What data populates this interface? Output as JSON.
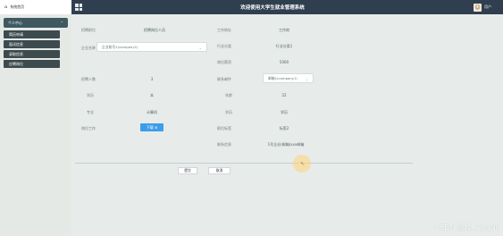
{
  "header": {
    "home_label": "系统首页",
    "title": "欢迎使用大学生就业管理系统",
    "user_name": "用户"
  },
  "sidebar": {
    "head_label": "个人中心",
    "items": [
      {
        "label": "简历申请"
      },
      {
        "label": "面试信息"
      },
      {
        "label": "录取信息"
      },
      {
        "label": "应聘岗位"
      }
    ]
  },
  "form": {
    "left": [
      {
        "label": "招聘职位",
        "value": "招聘岗位人员"
      },
      {
        "label": "企业名称",
        "value": "企业账号1(company1)"
      },
      {
        "label": "招聘人数",
        "value": "3"
      },
      {
        "label": "学历",
        "value": "本"
      },
      {
        "label": "专业",
        "value": "计算机"
      },
      {
        "label": "岗位工作",
        "button": "下载 ⊕"
      }
    ],
    "right": [
      {
        "label": "工作地址",
        "value": "工作地"
      },
      {
        "label": "行业分类",
        "value": "行业分类1"
      },
      {
        "label": "岗位薪资",
        "value": "5000"
      },
      {
        "label": "联系邮件",
        "value": "邮箱1(company1)"
      },
      {
        "label": "年龄",
        "value": "22"
      },
      {
        "label": "学历",
        "value": "学历"
      },
      {
        "label": "职位标签",
        "value": "标签2"
      },
      {
        "label": "联系信息",
        "value": "1号企业(邮箱)xxx邮箱"
      }
    ]
  },
  "actions": {
    "submit_label": "提交",
    "cancel_label": "取消"
  },
  "watermark": "CSDN @我_CXsjNo"
}
